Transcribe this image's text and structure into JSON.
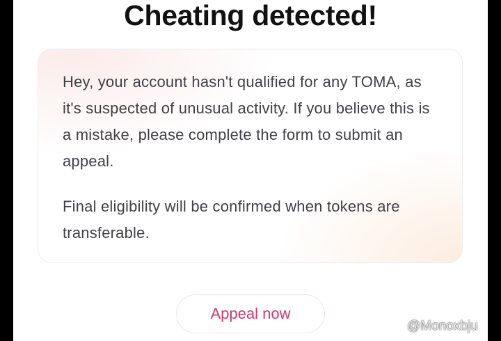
{
  "dialog": {
    "title": "Cheating detected!",
    "message_paragraph_1": "Hey, your account hasn't qualified for any TOMA, as it's suspected of unusual activity. If you believe this is a mistake, please complete the form to submit an appeal.",
    "message_paragraph_2": "Final eligibility will be confirmed when tokens are transferable.",
    "appeal_button_label": "Appeal now"
  },
  "watermark": {
    "text": "@Monoxbju",
    "icon": "diamond-logo-icon"
  },
  "colors": {
    "background": "#000000",
    "panel": "#ffffff",
    "title": "#111111",
    "body_text": "#3f3f46",
    "accent": "#d13a6b"
  }
}
